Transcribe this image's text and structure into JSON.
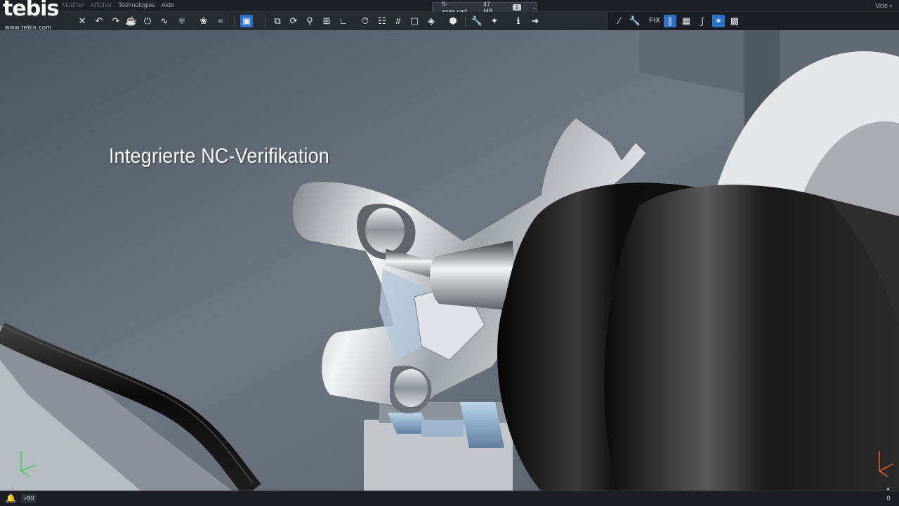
{
  "logo": {
    "word": "tebis",
    "url": "www.tebis.com"
  },
  "menu": [
    "Modifier",
    "Afficher",
    "Technologies",
    "Aide"
  ],
  "file": {
    "name": "5-axes.cad",
    "size": "47 MB",
    "count": "1"
  },
  "mode": "Vide",
  "toolbar": {
    "fix_label": "FIX"
  },
  "overlay_text": "Integrierte NC-Verifikation",
  "status": {
    "message_count": ">99",
    "right_count": "0"
  },
  "colors": {
    "accent": "#2e72c8",
    "chrome": "#1d2126",
    "background_wall": "#5a636d"
  }
}
